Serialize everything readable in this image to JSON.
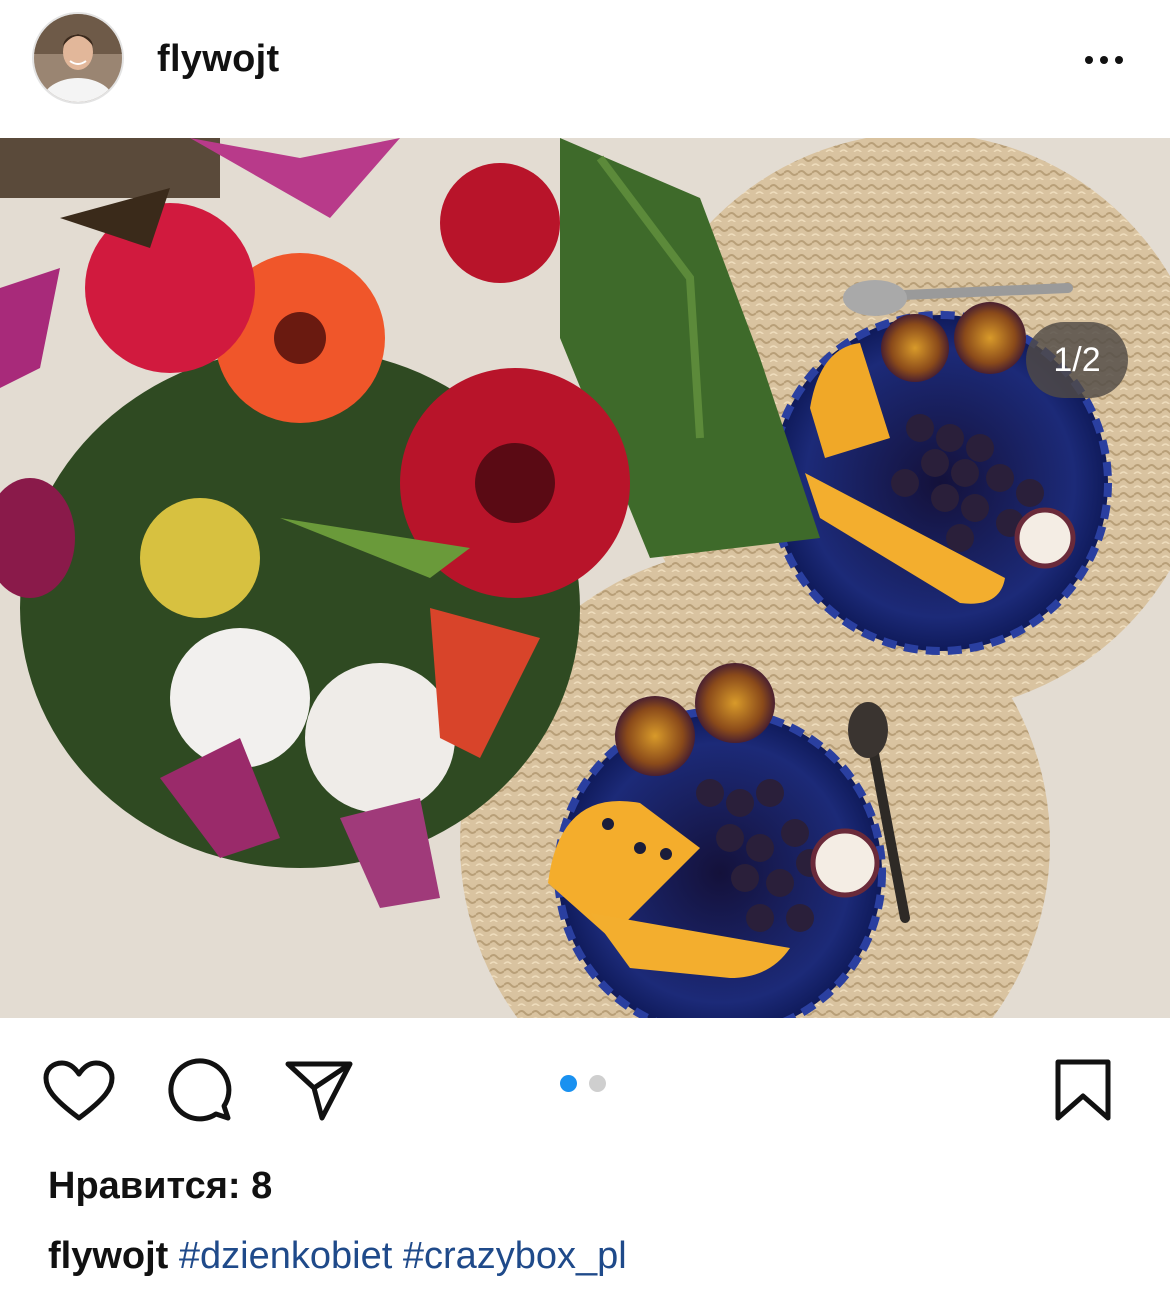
{
  "post": {
    "username": "flywojt",
    "image_counter": "1/2",
    "likes_text": "Нравится: 8",
    "caption": {
      "username": "flywojt",
      "hashtags": [
        "#dzienkobiet",
        "#crazybox_pl"
      ]
    },
    "carousel": {
      "total": 2,
      "current": 1
    }
  },
  "colors": {
    "accent_blue": "#1a91f0",
    "hashtag": "#1f4a8a"
  },
  "icons": [
    "more-options-icon",
    "heart-icon",
    "comment-icon",
    "share-icon",
    "bookmark-icon"
  ]
}
